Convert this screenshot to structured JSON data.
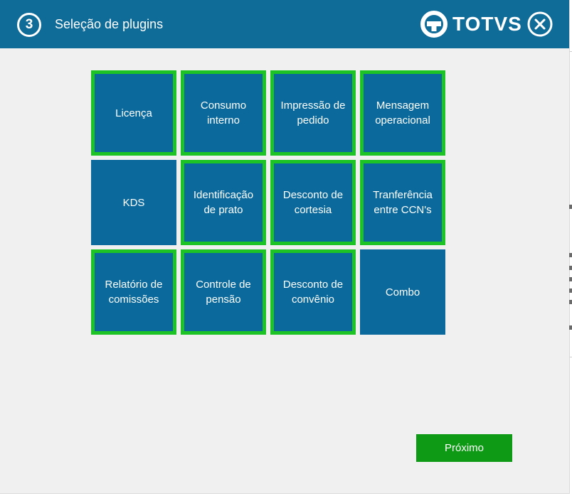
{
  "header": {
    "step_number": "3",
    "title": "Seleção de plugins",
    "brand": "TOTVS",
    "close_icon": "close-circle-icon",
    "logo_icon": "totvs-logo-icon"
  },
  "colors": {
    "header_bg": "#0f6b98",
    "tile_bg": "#0b6a9b",
    "selected_border": "#1dc324",
    "primary_button": "#0e9a14",
    "window_bg": "#f0f0f0"
  },
  "plugins": [
    {
      "lines": [
        "Licença"
      ],
      "selected": true
    },
    {
      "lines": [
        "Consumo",
        "interno"
      ],
      "selected": true
    },
    {
      "lines": [
        "Impressão de",
        "pedido"
      ],
      "selected": true
    },
    {
      "lines": [
        "Mensagem",
        "operacional"
      ],
      "selected": true
    },
    {
      "lines": [
        "KDS"
      ],
      "selected": false
    },
    {
      "lines": [
        "Identificação",
        "de prato"
      ],
      "selected": true
    },
    {
      "lines": [
        "Desconto de",
        "cortesia"
      ],
      "selected": true
    },
    {
      "lines": [
        "Tranferência",
        "entre CCN's"
      ],
      "selected": true
    },
    {
      "lines": [
        "Relatório de",
        "comissões"
      ],
      "selected": true
    },
    {
      "lines": [
        "Controle de",
        "pensão"
      ],
      "selected": true
    },
    {
      "lines": [
        "Desconto de",
        "convênio"
      ],
      "selected": true
    },
    {
      "lines": [
        "Combo"
      ],
      "selected": false
    }
  ],
  "footer": {
    "next_label": "Próximo"
  }
}
